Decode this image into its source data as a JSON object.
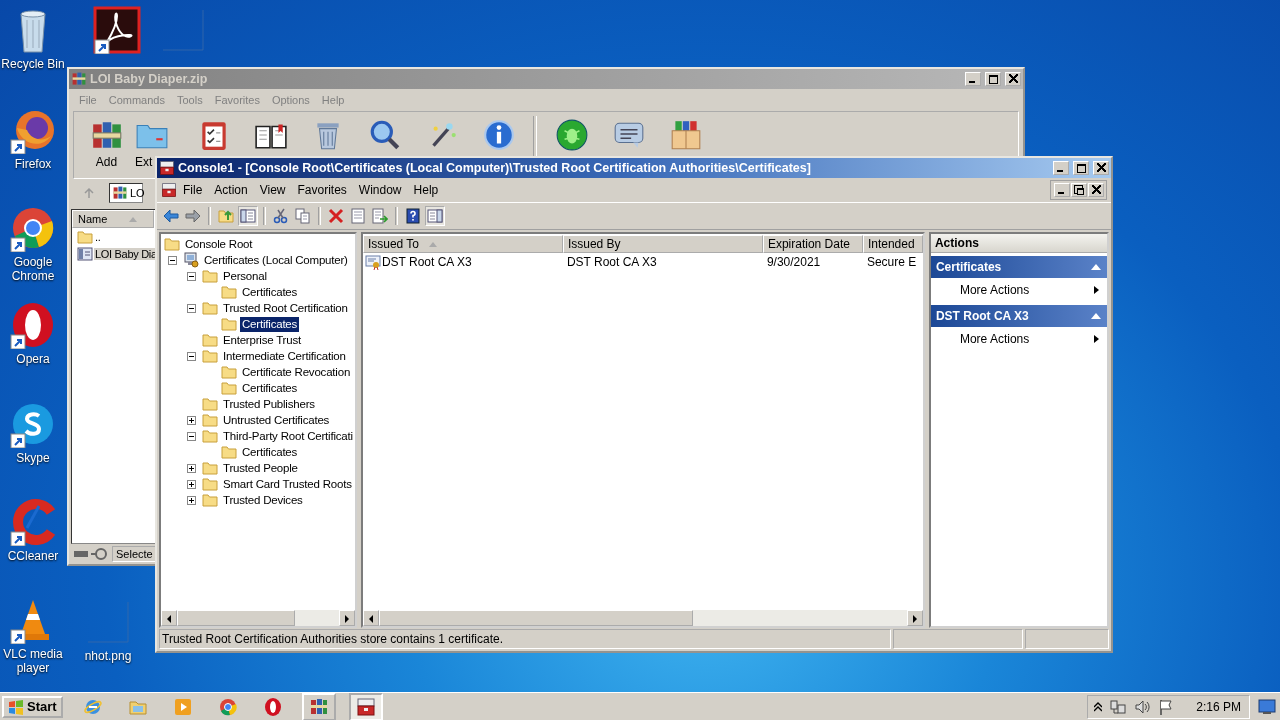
{
  "desktop_icons": [
    {
      "label": "Recycle Bin",
      "kind": "recycle"
    },
    {
      "kind": "acrobat"
    },
    {
      "kind": "blank"
    },
    {
      "label": "Firefox",
      "kind": "firefox"
    },
    {
      "label": "Google Chrome",
      "kind": "chrome"
    },
    {
      "label": "Opera",
      "kind": "opera"
    },
    {
      "label": "Skype",
      "kind": "skype"
    },
    {
      "label": "CCleaner",
      "kind": "ccleaner"
    },
    {
      "label": "VLC media player",
      "kind": "vlc"
    },
    {
      "label": "nhot.png",
      "kind": "blank"
    }
  ],
  "archiver": {
    "title": "LOI Baby Diaper.zip",
    "menu": [
      "File",
      "Commands",
      "Tools",
      "Favorites",
      "Options",
      "Help"
    ],
    "toolbar": [
      {
        "kind": "add",
        "label": "Add"
      },
      {
        "kind": "extract",
        "label": "Ext"
      },
      {
        "kind": "test"
      },
      {
        "kind": "view"
      },
      {
        "kind": "delete"
      },
      {
        "kind": "find"
      },
      {
        "kind": "wizard"
      },
      {
        "kind": "info"
      },
      {
        "kind": "virus"
      },
      {
        "kind": "comment"
      },
      {
        "kind": "sfx"
      }
    ],
    "path": "LO",
    "columns": [
      {
        "label": "Name",
        "sorted": true
      }
    ],
    "rows": [
      {
        "name": "..",
        "kind": "folder",
        "selected": false
      },
      {
        "name": "LOI Baby Dia",
        "kind": "archive",
        "selected": true
      }
    ],
    "status": "Selecte"
  },
  "console": {
    "title": "Console1 - [Console Root\\Certificates (Local Computer)\\Trusted Root Certification Authorities\\Certificates]",
    "menu": [
      "File",
      "Action",
      "View",
      "Favorites",
      "Window",
      "Help"
    ],
    "toolbar": [
      {
        "kind": "back"
      },
      {
        "kind": "forward"
      },
      {
        "kind": "up"
      },
      {
        "kind": "tree"
      },
      {
        "kind": "cut"
      },
      {
        "kind": "copy"
      },
      {
        "kind": "delete"
      },
      {
        "kind": "properties"
      },
      {
        "kind": "export"
      },
      {
        "kind": "help"
      },
      {
        "kind": "view"
      }
    ],
    "tree": [
      {
        "label": "Console Root",
        "kind": "folder",
        "selected": false,
        "children": [
          {
            "label": "Certificates (Local Computer)",
            "kind": "store",
            "expanded": true,
            "selected": false,
            "children": [
              {
                "label": "Personal",
                "kind": "folder",
                "expanded": true,
                "selected": false,
                "children": [
                  {
                    "label": "Certificates",
                    "kind": "folder",
                    "selected": false
                  }
                ]
              },
              {
                "label": "Trusted Root Certification",
                "kind": "folder",
                "expanded": true,
                "selected": false,
                "children": [
                  {
                    "label": "Certificates",
                    "kind": "folder",
                    "selected": true
                  }
                ]
              },
              {
                "label": "Enterprise Trust",
                "kind": "folder",
                "selected": false
              },
              {
                "label": "Intermediate Certification",
                "kind": "folder",
                "expanded": true,
                "selected": false,
                "children": [
                  {
                    "label": "Certificate Revocation",
                    "kind": "folder",
                    "selected": false
                  },
                  {
                    "label": "Certificates",
                    "kind": "folder",
                    "selected": false
                  }
                ]
              },
              {
                "label": "Trusted Publishers",
                "kind": "folder",
                "selected": false
              },
              {
                "label": "Untrusted Certificates",
                "kind": "folder",
                "expanded": false,
                "selected": false
              },
              {
                "label": "Third-Party Root Certificati",
                "kind": "folder",
                "expanded": true,
                "selected": false,
                "children": [
                  {
                    "label": "Certificates",
                    "kind": "folder",
                    "selected": false
                  }
                ]
              },
              {
                "label": "Trusted People",
                "kind": "folder",
                "expanded": false,
                "selected": false
              },
              {
                "label": "Smart Card Trusted Roots",
                "kind": "folder",
                "expanded": false,
                "selected": false
              },
              {
                "label": "Trusted Devices",
                "kind": "folder",
                "expanded": false,
                "selected": false
              }
            ]
          }
        ]
      }
    ],
    "columns": [
      {
        "label": "Issued To",
        "sorted": true
      },
      {
        "label": "Issued By",
        "sorted": false
      },
      {
        "label": "Expiration Date",
        "sorted": false
      },
      {
        "label": "Intended",
        "sorted": false
      }
    ],
    "rows": [
      {
        "cells": [
          "DST Root CA X3",
          "DST Root CA X3",
          "9/30/2021",
          "Secure E"
        ],
        "selected": false
      }
    ],
    "actions": {
      "title": "Actions",
      "sections": [
        {
          "title": "Certificates",
          "expanded": true,
          "items": [
            "More Actions"
          ]
        },
        {
          "title": "DST Root CA X3",
          "expanded": true,
          "items": [
            "More Actions"
          ]
        }
      ]
    },
    "status": "Trusted Root Certification Authorities store contains 1 certificate."
  },
  "taskbar": {
    "start": "Start",
    "apps": [
      {
        "kind": "ie",
        "open": false,
        "selected": false
      },
      {
        "kind": "explorer",
        "open": false,
        "selected": false
      },
      {
        "kind": "media",
        "open": false,
        "selected": false
      },
      {
        "kind": "chrome",
        "open": false,
        "selected": false
      },
      {
        "kind": "opera",
        "open": false,
        "selected": false
      },
      {
        "kind": "winrar",
        "open": true,
        "selected": false
      },
      {
        "kind": "mmc",
        "open": true,
        "selected": true
      }
    ],
    "clock": "2:16 PM"
  }
}
